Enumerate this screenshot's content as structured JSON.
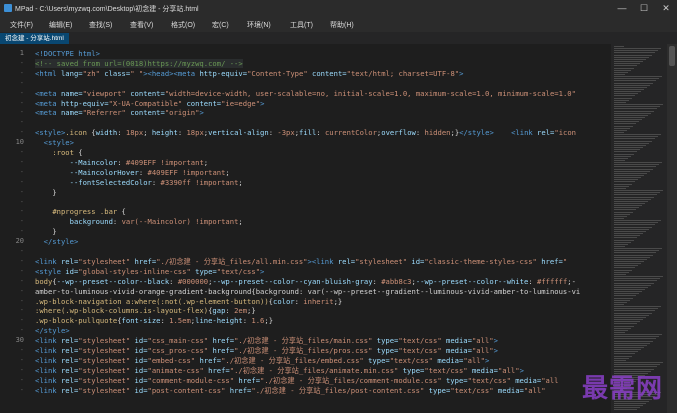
{
  "window": {
    "title": "MPad - C:\\Users\\myzwq.com\\Desktop\\初念建 - 分享站.html",
    "controls": {
      "minimize": "—",
      "maximize": "☐",
      "close": "✕"
    }
  },
  "menu": [
    "文件(F)",
    "编辑(E)",
    "查找(S)",
    "查看(V)",
    "格式(O)",
    "宏(C)",
    "环境(N)",
    "工具(T)",
    "帮助(H)"
  ],
  "tabs": [
    {
      "label": "初念建 - 分享站.html"
    }
  ],
  "editor": {
    "line_numbers": [
      {
        "t": "1",
        "major": true
      },
      {
        "t": "-",
        "major": false
      },
      {
        "t": "-",
        "major": false
      },
      {
        "t": "-",
        "major": false
      },
      {
        "t": "-",
        "major": false
      },
      {
        "t": "-",
        "major": false
      },
      {
        "t": "-",
        "major": false
      },
      {
        "t": "-",
        "major": false
      },
      {
        "t": "-",
        "major": false
      },
      {
        "t": "10",
        "major": true
      },
      {
        "t": "-",
        "major": false
      },
      {
        "t": "-",
        "major": false
      },
      {
        "t": "-",
        "major": false
      },
      {
        "t": "-",
        "major": false
      },
      {
        "t": "-",
        "major": false
      },
      {
        "t": "-",
        "major": false
      },
      {
        "t": "-",
        "major": false
      },
      {
        "t": "-",
        "major": false
      },
      {
        "t": "-",
        "major": false
      },
      {
        "t": "20",
        "major": true
      },
      {
        "t": "-",
        "major": false
      },
      {
        "t": "-",
        "major": false
      },
      {
        "t": "-",
        "major": false
      },
      {
        "t": "-",
        "major": false
      },
      {
        "t": "-",
        "major": false
      },
      {
        "t": "-",
        "major": false
      },
      {
        "t": "-",
        "major": false
      },
      {
        "t": "-",
        "major": false
      },
      {
        "t": "-",
        "major": false
      },
      {
        "t": "30",
        "major": true
      },
      {
        "t": "-",
        "major": false
      },
      {
        "t": "-",
        "major": false
      },
      {
        "t": "-",
        "major": false
      },
      {
        "t": "-",
        "major": false
      },
      {
        "t": "-",
        "major": false
      }
    ],
    "lines": [
      [
        [
          "t-tag",
          "<!DOCTYPE html>"
        ]
      ],
      [
        [
          "t-cmt",
          "<!-- saved from url=(0018)https://myzwq.com/ -->"
        ]
      ],
      [
        [
          "t-tag",
          "<html"
        ],
        [
          "t-attr",
          " lang="
        ],
        [
          "t-str",
          "\"zh\""
        ],
        [
          "t-attr",
          " class="
        ],
        [
          "t-str",
          "\" \""
        ],
        [
          "t-tag",
          "><head><meta"
        ],
        [
          "t-attr",
          " http-equiv="
        ],
        [
          "t-str",
          "\"Content-Type\""
        ],
        [
          "t-attr",
          " content="
        ],
        [
          "t-str",
          "\"text/html; charset=UTF-8\""
        ],
        [
          "t-tag",
          ">"
        ]
      ],
      [],
      [
        [
          "t-tag",
          "<meta"
        ],
        [
          "t-attr",
          " name="
        ],
        [
          "t-str",
          "\"viewport\""
        ],
        [
          "t-attr",
          " content="
        ],
        [
          "t-str",
          "\"width=device-width, user-scalable=no, initial-scale=1.0, maximum-scale=1.0, minimum-scale=1.0\""
        ]
      ],
      [
        [
          "t-tag",
          "<meta"
        ],
        [
          "t-attr",
          " http-equiv="
        ],
        [
          "t-str",
          "\"X-UA-Compatible\""
        ],
        [
          "t-attr",
          " content="
        ],
        [
          "t-str",
          "\"ie=edge\""
        ],
        [
          "t-tag",
          ">"
        ]
      ],
      [
        [
          "t-tag",
          "<meta"
        ],
        [
          "t-attr",
          " name="
        ],
        [
          "t-str",
          "\"Referrer\""
        ],
        [
          "t-attr",
          " content="
        ],
        [
          "t-str",
          "\"origin\""
        ],
        [
          "t-tag",
          ">"
        ]
      ],
      [],
      [
        [
          "t-tag",
          "<style>"
        ],
        [
          "t-sel",
          ".icon"
        ],
        [
          "t-pun",
          " {"
        ],
        [
          "t-prop",
          "width"
        ],
        [
          "t-pun",
          ": "
        ],
        [
          "t-val",
          "18px"
        ],
        [
          "t-pun",
          "; "
        ],
        [
          "t-prop",
          "height"
        ],
        [
          "t-pun",
          ": "
        ],
        [
          "t-val",
          "18px"
        ],
        [
          "t-pun",
          ";"
        ],
        [
          "t-prop",
          "vertical-align"
        ],
        [
          "t-pun",
          ": "
        ],
        [
          "t-val",
          "-3px"
        ],
        [
          "t-pun",
          ";"
        ],
        [
          "t-prop",
          "fill"
        ],
        [
          "t-pun",
          ": "
        ],
        [
          "t-val",
          "currentColor"
        ],
        [
          "t-pun",
          ";"
        ],
        [
          "t-prop",
          "overflow"
        ],
        [
          "t-pun",
          ": "
        ],
        [
          "t-val",
          "hidden"
        ],
        [
          "t-pun",
          ";}"
        ],
        [
          "t-tag",
          "</style>"
        ],
        [
          "t-pun",
          "    "
        ],
        [
          "t-tag",
          "<link"
        ],
        [
          "t-attr",
          " rel="
        ],
        [
          "t-str",
          "\"icon"
        ]
      ],
      [
        [
          "t-pun",
          "  "
        ],
        [
          "t-tag",
          "<style>"
        ]
      ],
      [
        [
          "t-pun",
          "    "
        ],
        [
          "t-sel",
          ":root"
        ],
        [
          "t-pun",
          " {"
        ]
      ],
      [
        [
          "t-pun",
          "        "
        ],
        [
          "t-prop",
          "--Maincolor"
        ],
        [
          "t-pun",
          ": "
        ],
        [
          "t-val",
          "#409EFF !important"
        ],
        [
          "t-pun",
          ";"
        ]
      ],
      [
        [
          "t-pun",
          "        "
        ],
        [
          "t-prop",
          "--MaincolorHover"
        ],
        [
          "t-pun",
          ": "
        ],
        [
          "t-val",
          "#409EFF !important"
        ],
        [
          "t-pun",
          ";"
        ]
      ],
      [
        [
          "t-pun",
          "        "
        ],
        [
          "t-prop",
          "--fontSelectedColor"
        ],
        [
          "t-pun",
          ": "
        ],
        [
          "t-val",
          "#3390ff !important"
        ],
        [
          "t-pun",
          ";"
        ]
      ],
      [
        [
          "t-pun",
          "    }"
        ]
      ],
      [],
      [
        [
          "t-pun",
          "    "
        ],
        [
          "t-sel",
          "#nprogress .bar"
        ],
        [
          "t-pun",
          " {"
        ]
      ],
      [
        [
          "t-pun",
          "        "
        ],
        [
          "t-prop",
          "background"
        ],
        [
          "t-pun",
          ": "
        ],
        [
          "t-val",
          "var(--Maincolor) !important"
        ],
        [
          "t-pun",
          ";"
        ]
      ],
      [
        [
          "t-pun",
          "    }"
        ]
      ],
      [
        [
          "t-pun",
          "  "
        ],
        [
          "t-tag",
          "</style>"
        ]
      ],
      [],
      [
        [
          "t-tag",
          "<link"
        ],
        [
          "t-attr",
          " rel="
        ],
        [
          "t-str",
          "\"stylesheet\""
        ],
        [
          "t-attr",
          " href="
        ],
        [
          "t-str",
          "\"./初念建 - 分享站_files/all.min.css\""
        ],
        [
          "t-tag",
          "><link"
        ],
        [
          "t-attr",
          " rel="
        ],
        [
          "t-str",
          "\"stylesheet\""
        ],
        [
          "t-attr",
          " id="
        ],
        [
          "t-str",
          "\"classic-theme-styles-css\""
        ],
        [
          "t-attr",
          " href="
        ],
        [
          "t-str",
          "\""
        ]
      ],
      [
        [
          "t-tag",
          "<style"
        ],
        [
          "t-attr",
          " id="
        ],
        [
          "t-str",
          "\"global-styles-inline-css\""
        ],
        [
          "t-attr",
          " type="
        ],
        [
          "t-str",
          "\"text/css\""
        ],
        [
          "t-tag",
          ">"
        ]
      ],
      [
        [
          "t-sel",
          "body"
        ],
        [
          "t-pun",
          "{"
        ],
        [
          "t-prop",
          "--wp--preset--color--black"
        ],
        [
          "t-pun",
          ": "
        ],
        [
          "t-val",
          "#000000"
        ],
        [
          "t-pun",
          ";"
        ],
        [
          "t-prop",
          "--wp--preset--color--cyan-bluish-gray"
        ],
        [
          "t-pun",
          ": "
        ],
        [
          "t-val",
          "#abb8c3"
        ],
        [
          "t-pun",
          ";"
        ],
        [
          "t-prop",
          "--wp--preset--color--white"
        ],
        [
          "t-pun",
          ": "
        ],
        [
          "t-val",
          "#ffffff"
        ],
        [
          "t-pun",
          ";-"
        ]
      ],
      [
        [
          "t-txt",
          "amber-to-luminous-vivid-orange-gradient-background{background: var(--wp--preset--gradient--luminous-vivid-amber-to-luminous-vi"
        ]
      ],
      [
        [
          "t-sel",
          ".wp-block-navigation a:where(:not(.wp-element-button))"
        ],
        [
          "t-pun",
          "{"
        ],
        [
          "t-prop",
          "color"
        ],
        [
          "t-pun",
          ": "
        ],
        [
          "t-val",
          "inherit"
        ],
        [
          "t-pun",
          ";}"
        ]
      ],
      [
        [
          "t-sel",
          ":where(.wp-block-columns.is-layout-flex)"
        ],
        [
          "t-pun",
          "{"
        ],
        [
          "t-prop",
          "gap"
        ],
        [
          "t-pun",
          ": "
        ],
        [
          "t-val",
          "2em"
        ],
        [
          "t-pun",
          ";}"
        ]
      ],
      [
        [
          "t-sel",
          ".wp-block-pullquote"
        ],
        [
          "t-pun",
          "{"
        ],
        [
          "t-prop",
          "font-size"
        ],
        [
          "t-pun",
          ": "
        ],
        [
          "t-val",
          "1.5em"
        ],
        [
          "t-pun",
          ";"
        ],
        [
          "t-prop",
          "line-height"
        ],
        [
          "t-pun",
          ": "
        ],
        [
          "t-val",
          "1.6"
        ],
        [
          "t-pun",
          ";}"
        ]
      ],
      [
        [
          "t-tag",
          "</style>"
        ]
      ],
      [
        [
          "t-tag",
          "<link"
        ],
        [
          "t-attr",
          " rel="
        ],
        [
          "t-str",
          "\"stylesheet\""
        ],
        [
          "t-attr",
          " id="
        ],
        [
          "t-str",
          "\"css_main-css\""
        ],
        [
          "t-attr",
          " href="
        ],
        [
          "t-str",
          "\"./初念建 - 分享站_files/main.css\""
        ],
        [
          "t-attr",
          " type="
        ],
        [
          "t-str",
          "\"text/css\""
        ],
        [
          "t-attr",
          " media="
        ],
        [
          "t-str",
          "\"all\""
        ],
        [
          "t-tag",
          ">"
        ]
      ],
      [
        [
          "t-tag",
          "<link"
        ],
        [
          "t-attr",
          " rel="
        ],
        [
          "t-str",
          "\"stylesheet\""
        ],
        [
          "t-attr",
          " id="
        ],
        [
          "t-str",
          "\"css_pros-css\""
        ],
        [
          "t-attr",
          " href="
        ],
        [
          "t-str",
          "\"./初念建 - 分享站_files/pros.css\""
        ],
        [
          "t-attr",
          " type="
        ],
        [
          "t-str",
          "\"text/css\""
        ],
        [
          "t-attr",
          " media="
        ],
        [
          "t-str",
          "\"all\""
        ],
        [
          "t-tag",
          ">"
        ]
      ],
      [
        [
          "t-tag",
          "<link"
        ],
        [
          "t-attr",
          " rel="
        ],
        [
          "t-str",
          "\"stylesheet\""
        ],
        [
          "t-attr",
          " id="
        ],
        [
          "t-str",
          "\"embed-css\""
        ],
        [
          "t-attr",
          " href="
        ],
        [
          "t-str",
          "\"./初念建 - 分享站_files/embed.css\""
        ],
        [
          "t-attr",
          " type="
        ],
        [
          "t-str",
          "\"text/css\""
        ],
        [
          "t-attr",
          " media="
        ],
        [
          "t-str",
          "\"all\""
        ],
        [
          "t-tag",
          ">"
        ]
      ],
      [
        [
          "t-tag",
          "<link"
        ],
        [
          "t-attr",
          " rel="
        ],
        [
          "t-str",
          "\"stylesheet\""
        ],
        [
          "t-attr",
          " id="
        ],
        [
          "t-str",
          "\"animate-css\""
        ],
        [
          "t-attr",
          " href="
        ],
        [
          "t-str",
          "\"./初念建 - 分享站_files/animate.min.css\""
        ],
        [
          "t-attr",
          " type="
        ],
        [
          "t-str",
          "\"text/css\""
        ],
        [
          "t-attr",
          " media="
        ],
        [
          "t-str",
          "\"all\""
        ],
        [
          "t-tag",
          ">"
        ]
      ],
      [
        [
          "t-tag",
          "<link"
        ],
        [
          "t-attr",
          " rel="
        ],
        [
          "t-str",
          "\"stylesheet\""
        ],
        [
          "t-attr",
          " id="
        ],
        [
          "t-str",
          "\"comment-module-css\""
        ],
        [
          "t-attr",
          " href="
        ],
        [
          "t-str",
          "\"./初念建 - 分享站_files/comment-module.css\""
        ],
        [
          "t-attr",
          " type="
        ],
        [
          "t-str",
          "\"text/css\""
        ],
        [
          "t-attr",
          " media="
        ],
        [
          "t-str",
          "\"all"
        ]
      ],
      [
        [
          "t-tag",
          "<link"
        ],
        [
          "t-attr",
          " rel="
        ],
        [
          "t-str",
          "\"stylesheet\""
        ],
        [
          "t-attr",
          " id="
        ],
        [
          "t-str",
          "\"post-content-css\""
        ],
        [
          "t-attr",
          " href="
        ],
        [
          "t-str",
          "\"./初念建 - 分享站_files/post-content.css\""
        ],
        [
          "t-attr",
          " type="
        ],
        [
          "t-str",
          "\"text/css\""
        ],
        [
          "t-attr",
          " media="
        ],
        [
          "t-str",
          "\"all\""
        ]
      ]
    ],
    "current_line_index": 1
  },
  "watermark": "最需网"
}
